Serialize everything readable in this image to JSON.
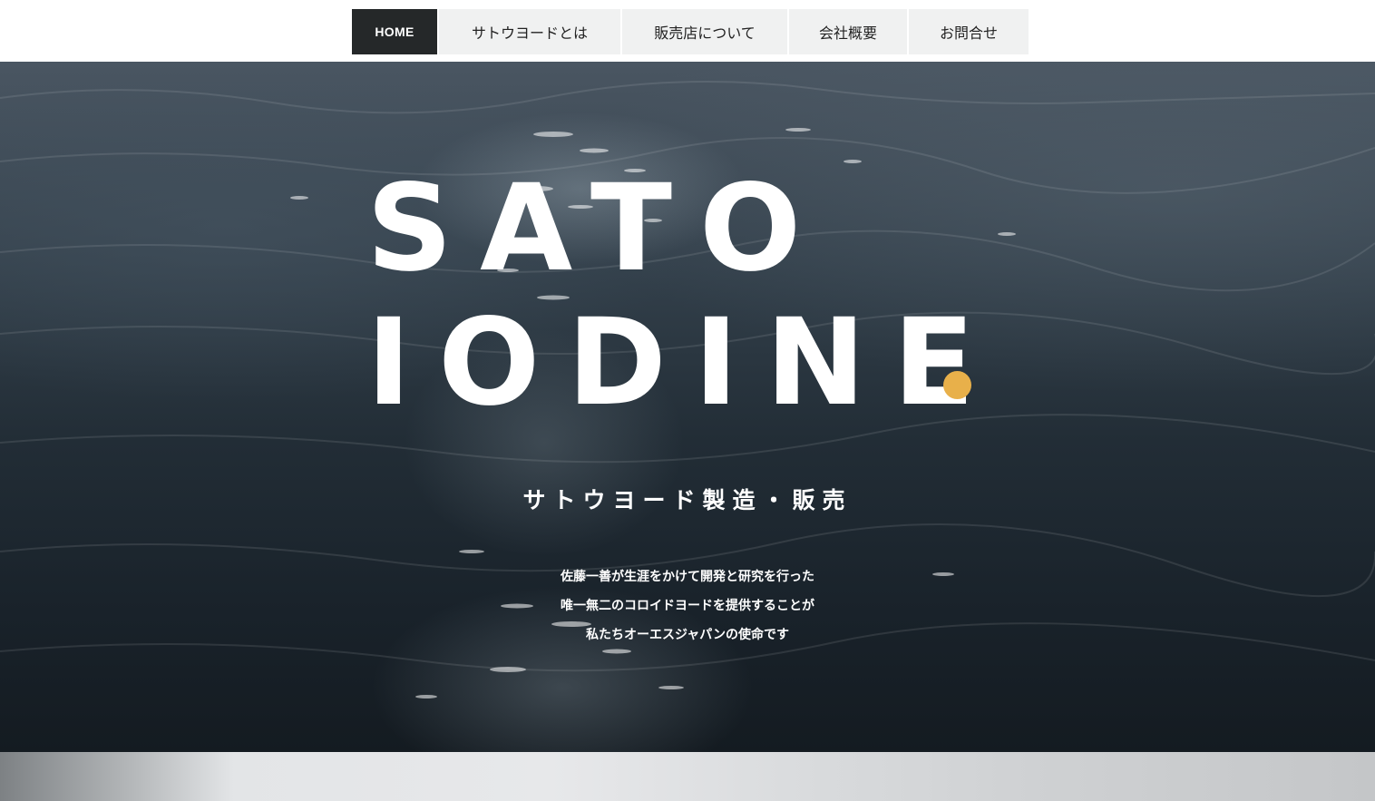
{
  "nav": {
    "items": [
      {
        "label": "HOME"
      },
      {
        "label": "サトウヨードとは"
      },
      {
        "label": "販売店について"
      },
      {
        "label": "会社概要"
      },
      {
        "label": "お問合せ"
      }
    ]
  },
  "hero": {
    "title_line1": "SATO",
    "title_line2": "IODINE",
    "subtitle": "サトウヨード製造・販売",
    "description": [
      "佐藤一善が生涯をかけて開発と研究を行った",
      "唯一無二のコロイドヨードを提供することが",
      "私たちオーエスジャパンの使命です"
    ]
  },
  "colors": {
    "accent": "#e8b04a",
    "nav_active_bg": "#252829",
    "nav_bg": "#f0f1f1"
  }
}
